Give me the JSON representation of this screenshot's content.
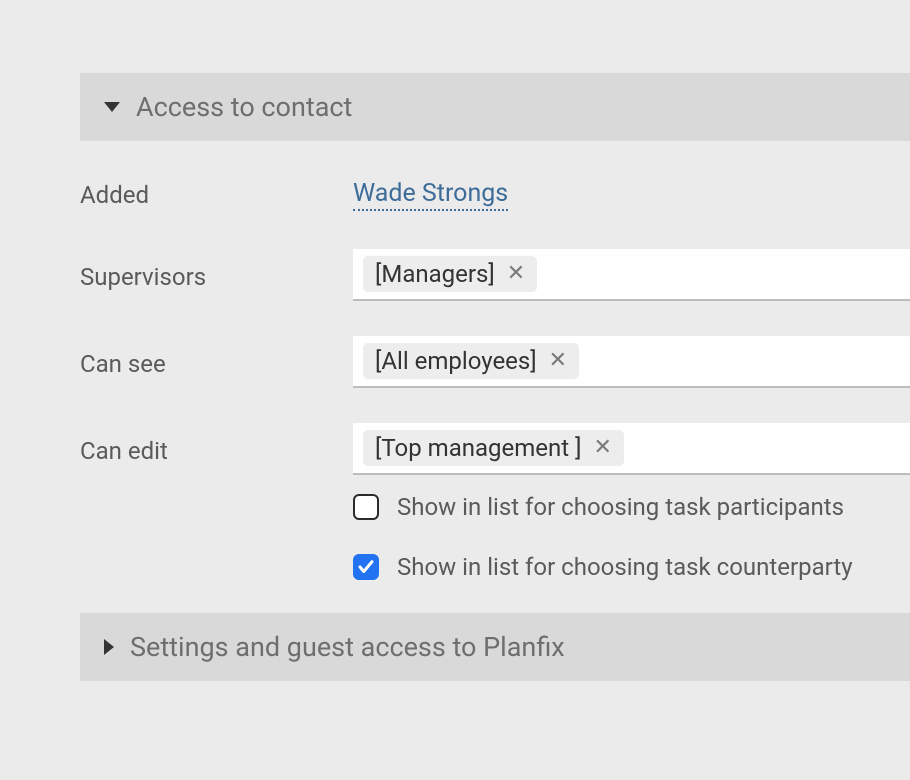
{
  "sections": {
    "access": {
      "title": "Access to contact",
      "expanded": true
    },
    "settings": {
      "title": "Settings and guest access to Planfix",
      "expanded": false
    }
  },
  "fields": {
    "added": {
      "label": "Added",
      "value": "Wade Strongs"
    },
    "supervisors": {
      "label": "Supervisors",
      "tags": [
        "[Managers]"
      ]
    },
    "can_see": {
      "label": "Can see",
      "tags": [
        "[All employees]"
      ]
    },
    "can_edit": {
      "label": "Can edit",
      "tags": [
        "[Top management ]"
      ]
    }
  },
  "checkboxes": {
    "show_participants": {
      "label": "Show in list for choosing task participants",
      "checked": false
    },
    "show_counterparty": {
      "label": "Show in list for choosing task counterparty",
      "checked": true
    }
  }
}
